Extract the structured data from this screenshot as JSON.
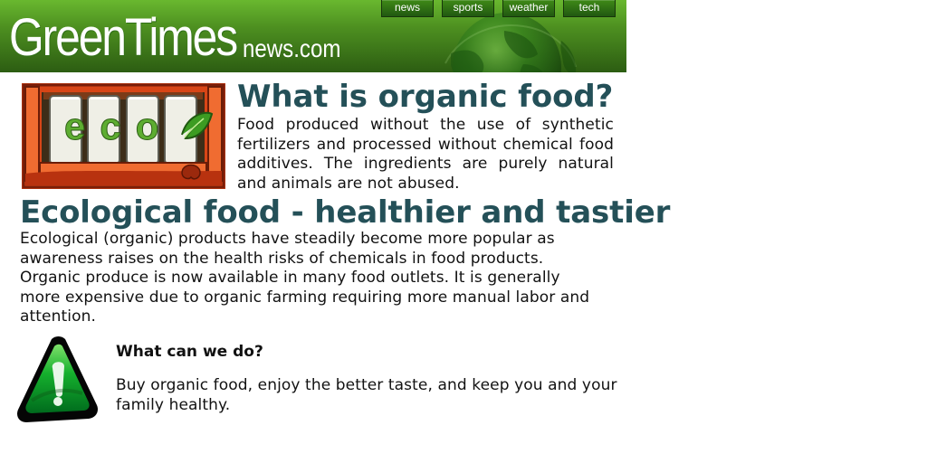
{
  "header": {
    "brand_main": "GreenTimes",
    "brand_sub": "news.com",
    "nav": [
      {
        "label": "news",
        "icon": "tab"
      },
      {
        "label": "sports",
        "icon": "tab"
      },
      {
        "label": "weather",
        "icon": "tab"
      },
      {
        "label": "tech",
        "icon": "tab"
      }
    ],
    "colors": {
      "header_top": "#69b82f",
      "header_bottom": "#2c5d12",
      "tab_top": "#3f8a17",
      "tab_bottom": "#215811"
    },
    "decorative_icon": "globe-icon"
  },
  "section_1": {
    "image_label": "eco",
    "headline": "What is organic food?",
    "text": "Food produced without the use of synthetic fertilizers and processed without chemical food additives. The ingredients are purely natural and animals are not abused."
  },
  "section_2": {
    "headline": "Ecological food - healthier and tastier",
    "text": "Ecological (organic) products have steadily become more popular as awareness raises on the health risks of chemicals in food products. Organic produce is now available in many food outlets. It is generally more expensive due to organic farming requiring more manual labor and attention."
  },
  "action": {
    "icon": "warning-icon",
    "title": "What can we do?",
    "text": "Buy organic food, enjoy the better taste, and keep you and your family healthy."
  },
  "colors": {
    "headline": "#245058",
    "body": "#121212",
    "eco_frame": "#d84516",
    "eco_leaf": "#3c9c22"
  }
}
